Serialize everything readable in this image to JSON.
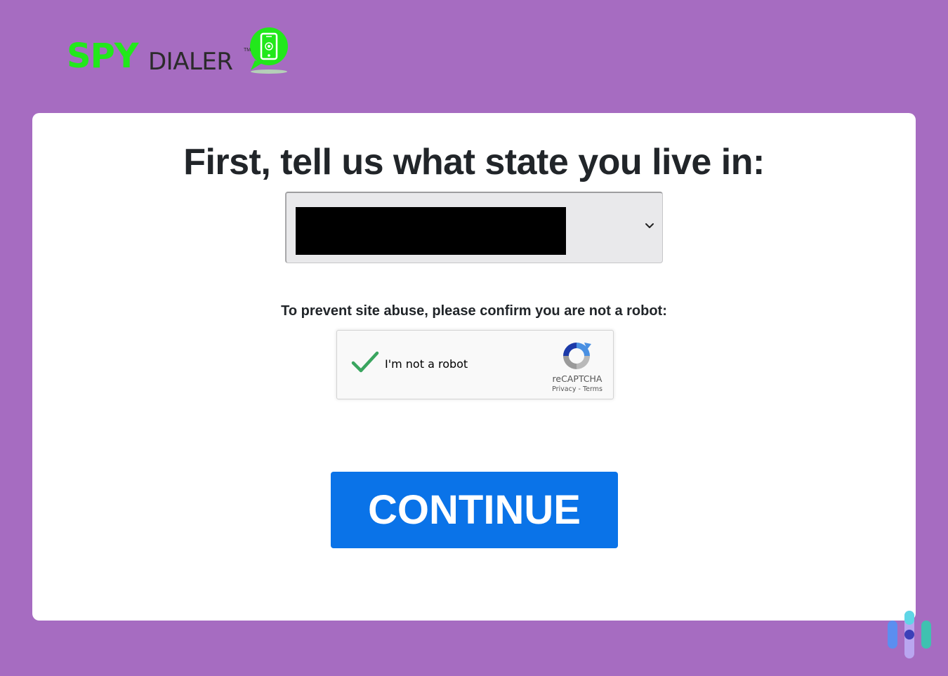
{
  "logo": {
    "spy": "SPY",
    "dialer": "DIALER",
    "trademark": "TM",
    "icon": "phone-bubble-icon",
    "colors": {
      "spy": "#22e81b",
      "dialer": "#2b2b2b",
      "bubble": "#22e81b"
    }
  },
  "form": {
    "title": "First, tell us what state you live in:",
    "state_select": {
      "selected_value": "",
      "redacted": true,
      "icon": "chevron-down-icon"
    },
    "robot_prompt": "To prevent site abuse, please confirm you are not a robot:",
    "recaptcha": {
      "label": "I'm not a robot",
      "checked": true,
      "brand": "reCAPTCHA",
      "privacy": "Privacy",
      "separator": " - ",
      "terms": "Terms",
      "icons": [
        "checkmark-icon",
        "recaptcha-logo-icon"
      ]
    },
    "continue_label": "CONTINUE"
  },
  "watermark": {
    "icon": "brand-bars-icon"
  },
  "colors": {
    "background": "#a66cc1",
    "card": "#ffffff",
    "button": "#0a73e8",
    "checkmark": "#3aa55f",
    "text": "#212529"
  }
}
